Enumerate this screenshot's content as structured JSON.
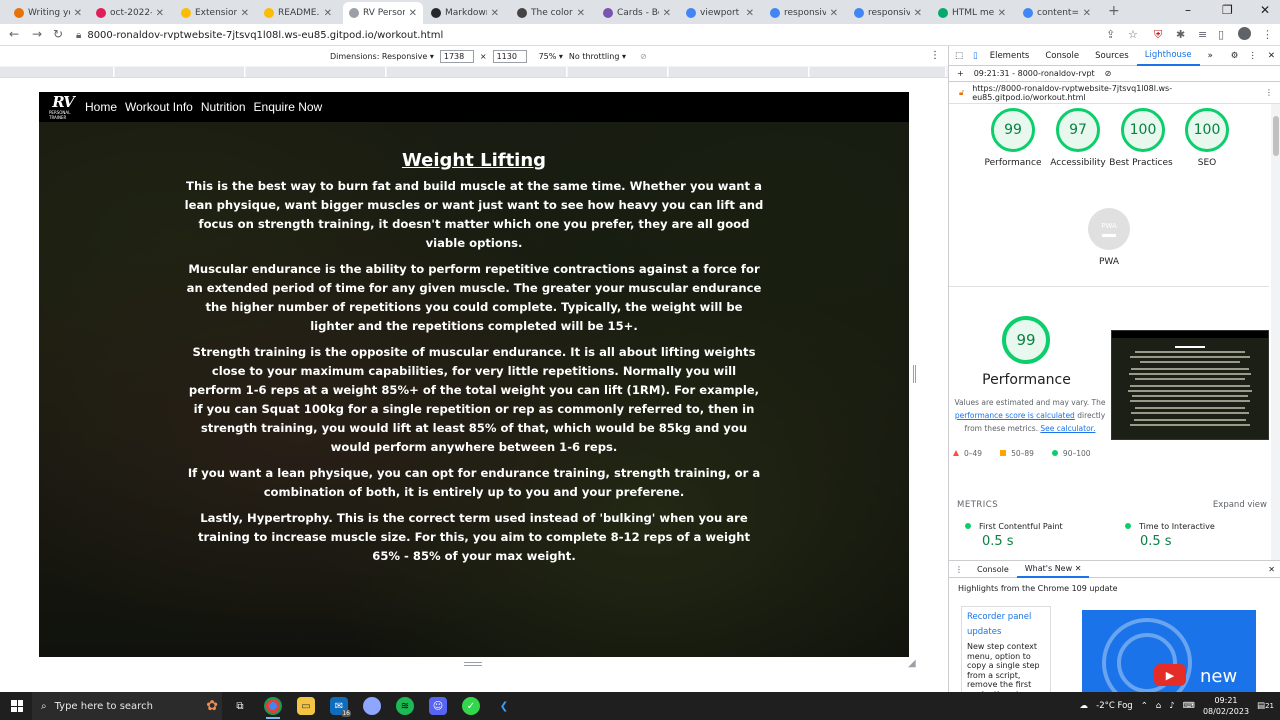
{
  "browser": {
    "tabs": [
      {
        "title": "Writing you",
        "color": "#e8710a"
      },
      {
        "title": "oct-2022-l",
        "color": "#e01e5a"
      },
      {
        "title": "Extension A",
        "color": "#fbbc04"
      },
      {
        "title": "README.m",
        "color": "#fbbc04"
      },
      {
        "title": "RV Persona",
        "color": "#9aa0a6",
        "active": true
      },
      {
        "title": "Markdown",
        "color": "#24292f"
      },
      {
        "title": "The color s",
        "color": "#444"
      },
      {
        "title": "Cards - Boo",
        "color": "#7952b3"
      },
      {
        "title": "viewport m",
        "color": "#4285f4"
      },
      {
        "title": "responsive",
        "color": "#4285f4"
      },
      {
        "title": "responsive",
        "color": "#4285f4"
      },
      {
        "title": "HTML meta",
        "color": "#04aa6d"
      },
      {
        "title": "content=\"v",
        "color": "#4285f4"
      }
    ],
    "new_tab": "+",
    "url": "8000-ronaldov-rvptwebsite-7jtsvq1l08l.ws-eu85.gitpod.io/workout.html"
  },
  "device_toolbar": {
    "dimensions_label": "Dimensions: Responsive ▾",
    "width": "1738",
    "height": "1130",
    "times": "×",
    "zoom": "75% ▾",
    "throttle": "No throttling ▾"
  },
  "site": {
    "logo_text": "RV",
    "logo_sub": "PERSONAL TRAINER",
    "nav": [
      "Home",
      "Workout Info",
      "Nutrition",
      "Enquire Now"
    ],
    "heading": "Weight Lifting",
    "paragraphs": [
      "This is the best way to burn fat and build muscle at the same time. Whether you want a lean physique, want bigger muscles or want just want to see how heavy you can lift and focus on strength training, it doesn't matter which one you prefer, they are all good viable options.",
      "Muscular endurance is the ability to perform repetitive contractions against a force for an extended period of time for any given muscle. The greater your muscular endurance the higher number of repetitions you could complete. Typically, the weight will be lighter and the repetitions completed will be 15+.",
      "Strength training is the opposite of muscular endurance. It is all about lifting weights close to your maximum capabilities, for very little repetitions. Normally you will perform 1-6 reps at a weight 85%+ of the total weight you can lift (1RM). For example, if you can Squat 100kg for a single repetition or rep as commonly referred to, then in strength training, you would lift at least 85% of that, which would be 85kg and you would perform anywhere between 1-6 reps.",
      "If you want a lean physique, you can opt for endurance training, strength training, or a combination of both, it is entirely up to you and your preferene.",
      "Lastly, Hypertrophy. This is the correct term used instead of 'bulking' when you are training to increase muscle size. For this, you aim to complete 8-12 reps of a weight 65% - 85% of your max weight."
    ]
  },
  "devtools": {
    "tabs": [
      "Elements",
      "Console",
      "Sources",
      "Lighthouse"
    ],
    "active_tab": "Lighthouse",
    "more_tabs": "»",
    "report_label": "09:21:31 - 8000-ronaldov-rvpt",
    "report_url": "https://8000-ronaldov-rvptwebsite-7jtsvq1l08l.ws-eu85.gitpod.io/workout.html",
    "scores": [
      {
        "label": "Performance",
        "value": "99"
      },
      {
        "label": "Accessibility",
        "value": "97"
      },
      {
        "label": "Best Practices",
        "value": "100"
      },
      {
        "label": "SEO",
        "value": "100"
      }
    ],
    "pwa_label": "PWA",
    "pwa_badge": "PWA",
    "main_score": "99",
    "main_title": "Performance",
    "note_prefix": "Values are estimated and may vary. The",
    "note_link1": "performance score is calculated",
    "note_mid": "directly from these metrics.",
    "note_link2": "See calculator.",
    "legend": [
      {
        "range": "0–49",
        "color": "#ff4e42",
        "shape": "triangle"
      },
      {
        "range": "50–89",
        "color": "#ffa400",
        "shape": "square"
      },
      {
        "range": "90–100",
        "color": "#0cce6b",
        "shape": "circle"
      }
    ],
    "metrics_heading": "METRICS",
    "expand_view": "Expand view",
    "metrics": [
      {
        "name": "First Contentful Paint",
        "value": "0.5 s"
      },
      {
        "name": "Time to Interactive",
        "value": "0.5 s"
      }
    ],
    "drawer_tabs": [
      "Console",
      "What's New"
    ],
    "drawer_active": "What's New",
    "highlights": "Highlights from the Chrome 109 update",
    "card_title": "Recorder panel updates",
    "card_text": "New step context menu, option to copy a single step from a script, remove the first navigation step, and",
    "video_text": "new"
  },
  "taskbar": {
    "search_placeholder": "Type here to search",
    "weather": "-2°C  Fog",
    "time": "09:21",
    "date": "08/02/2023",
    "notification_count": "21",
    "badge_count": "16"
  }
}
